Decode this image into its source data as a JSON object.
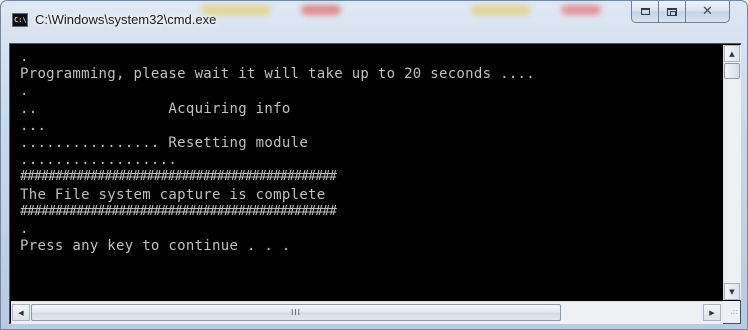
{
  "window": {
    "title": "C:\\Windows\\system32\\cmd.exe",
    "icon_text": "C:\\",
    "controls": {
      "minimize_icon": "minimize-icon",
      "maximize_icon": "maximize-icon",
      "close_icon": "close-icon",
      "close_glyph": "✕"
    }
  },
  "console": {
    "lines": [
      ".",
      "Programming, please wait it will take up to 20 seconds ....",
      ".",
      "..               Acquiring info",
      "...",
      "................ Resetting module",
      "..................",
      "#############################################",
      "The File system capture is complete",
      "#############################################",
      ".",
      "Press any key to continue . . ."
    ],
    "text_color": "#c0c0c0",
    "background_color": "#000000"
  },
  "scrollbars": {
    "up_arrow": "▲",
    "down_arrow": "▼",
    "left_arrow": "◀",
    "right_arrow": "▶",
    "thumb_grip": "III",
    "resize_grip": ".::"
  }
}
